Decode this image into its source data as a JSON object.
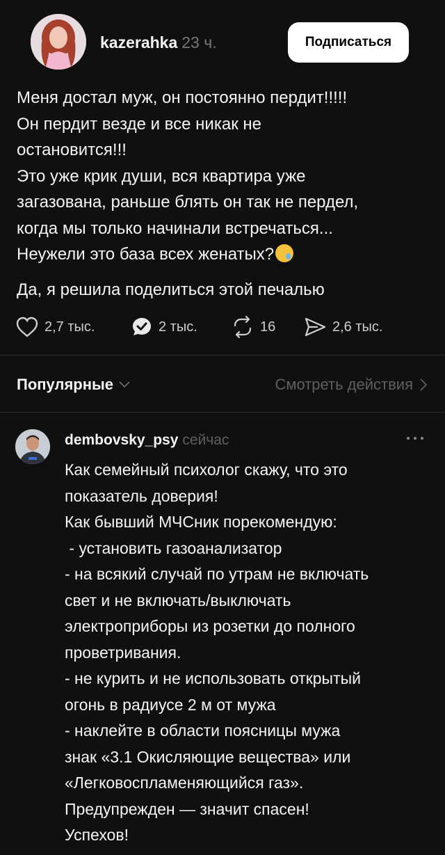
{
  "post": {
    "author": "kazerahka",
    "time": "23 ч.",
    "follow_label": "Подписаться",
    "text_lines": [
      "Меня достал муж, он постоянно пердит!!!!!",
      "Он пердит везде и все никак не",
      "остановится!!!",
      "Это уже крик души, вся квартира уже",
      "загазована, раньше блять он так не пердел,",
      "когда мы только начинали встречаться...",
      "Неужели это база всех женатых?"
    ],
    "second_paragraph": "Да, я решила поделиться этой печалью",
    "emoji": "crying-face-emoji"
  },
  "actions": {
    "likes": "2,7 тыс.",
    "comments": "2 тыс.",
    "reposts": "16",
    "shares": "2,6 тыс."
  },
  "sort": {
    "label": "Популярные",
    "view_activity": "Смотреть действия"
  },
  "reply": {
    "author": "dembovsky_psy",
    "time": "сейчас",
    "text_lines": [
      "Как семейный психолог скажу, что это",
      "показатель доверия!",
      "Как бывший МЧСник порекомендую:",
      " - установить газоанализатор",
      "- на всякий случай по утрам не включать",
      "свет и не включать/выключать",
      "электроприборы из розетки до полного",
      "проветривания.",
      "- не курить и не использовать открытый",
      "огонь в радиусе 2 м от мужа",
      "- наклейте в области поясницы мужа",
      "знак «3.1 Окисляющие вещества» или",
      "«Легковоспламеняющийся газ».",
      "Предупрежден — значит спасен!",
      "Успехов!"
    ]
  },
  "colors": {
    "background": "#101010",
    "text": "#f3f5f7",
    "muted": "#5f5f5f",
    "button_bg": "#ffffff"
  }
}
